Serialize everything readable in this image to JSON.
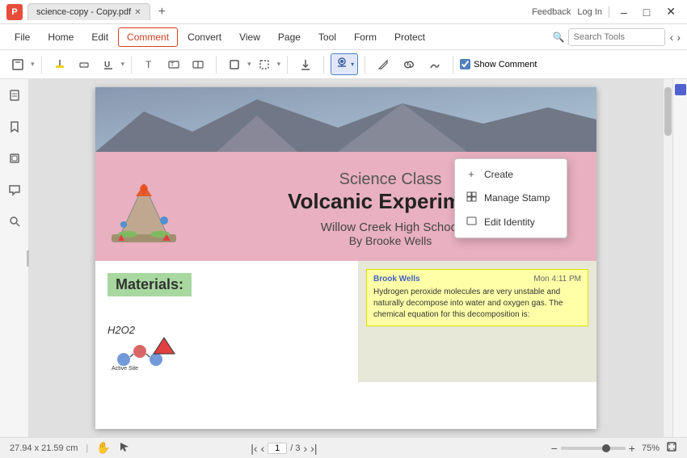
{
  "titlebar": {
    "filename": "science-copy - Copy.pdf",
    "app_icon": "P",
    "feedback": "Feedback",
    "login": "Log In",
    "new_tab": "+"
  },
  "menubar": {
    "items": [
      "Home",
      "Edit",
      "Comment",
      "Convert",
      "View",
      "Page",
      "Tool",
      "Form",
      "Protect"
    ],
    "active_item": "Comment",
    "search_placeholder": "Search Tools"
  },
  "toolbar": {
    "buttons": [
      "undo",
      "redo",
      "history-down",
      "annotate",
      "highlight",
      "eraser",
      "underline",
      "text",
      "textbox",
      "insert",
      "shape",
      "area",
      "stamp",
      "link",
      "sign"
    ]
  },
  "stamp_dropdown": {
    "items": [
      {
        "id": "create",
        "label": "Create",
        "icon": "+"
      },
      {
        "id": "manage",
        "label": "Manage Stamp",
        "icon": "⊞"
      },
      {
        "id": "identity",
        "label": "Edit Identity",
        "icon": "☐"
      }
    ]
  },
  "document": {
    "title_line1": "Science Class",
    "title_line2": "Volcanic Experiment",
    "school": "Willow Creek High School",
    "author": "By Brooke Wells",
    "materials_label": "Materials:",
    "annotation": {
      "author": "Brook Wells",
      "time": "Mon 4:11 PM",
      "text": "Hydrogen peroxide molecules are very unstable and naturally decompose into water and oxygen gas. The chemical equation for this decomposition is:"
    },
    "h2o2_text": "H2O2"
  },
  "statusbar": {
    "dimensions": "27.94 x 21.59 cm",
    "page_current": "1",
    "page_total": "3",
    "zoom": "75%"
  },
  "show_comment_label": "Show Comment"
}
